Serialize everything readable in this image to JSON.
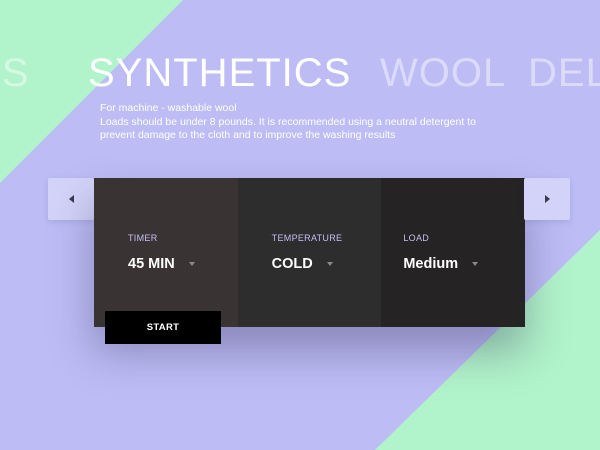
{
  "modes": [
    {
      "label": "NS",
      "state": "inactive"
    },
    {
      "label": "SYNTHETICS",
      "state": "active"
    },
    {
      "label": "WOOL",
      "state": "inactive"
    },
    {
      "label": "DEL",
      "state": "inactive"
    }
  ],
  "description": {
    "line1": "For machine - washable wool",
    "line2": "Loads should be under 8 pounds. It is recommended using a neutral detergent to prevent damage to the cloth and to improve the washing results"
  },
  "settings": {
    "timer": {
      "label": "TIMER",
      "value": "45 MIN"
    },
    "temperature": {
      "label": "TEMPERATURE",
      "value": "COLD"
    },
    "load": {
      "label": "LOAD",
      "value": "Medium"
    }
  },
  "start_label": "START",
  "colors": {
    "background": "#bdbcf5",
    "accent_green": "#b1f3ca",
    "label_color": "#c4bff6"
  },
  "icons": {
    "prev": "triangle-left-icon",
    "next": "triangle-right-icon",
    "dropdown": "caret-down-icon"
  }
}
